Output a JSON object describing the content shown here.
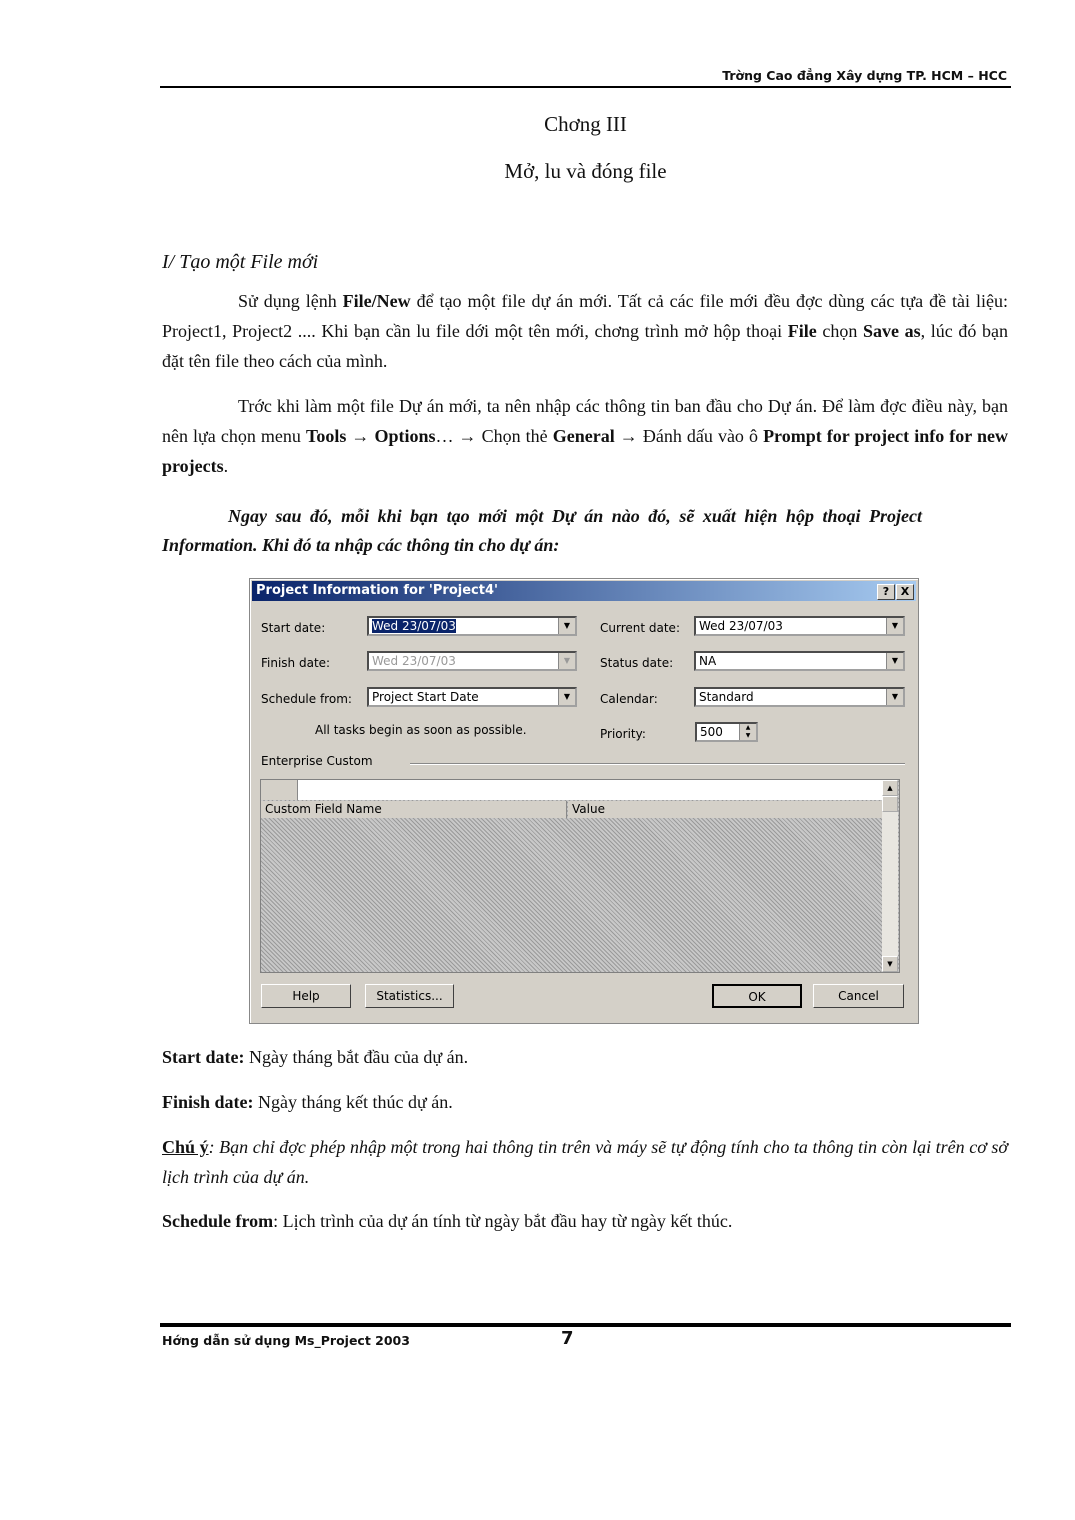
{
  "header": {
    "school": "Trờng   Cao đẳng Xây dựng TP. HCM – HCC"
  },
  "chapter": {
    "number": "Chơng   III",
    "title": "Mở, lu   và đóng file"
  },
  "section": {
    "heading": "I/ Tạo một File mới"
  },
  "para1": {
    "s1": "Sử dụng lệnh ",
    "b1": "File/New",
    "s2": " để tạo một file dự án mới. Tất cả các file mới đều đợc   dùng các tựa đề tài liệu: Project1, Project2 .... Khi bạn cần lu   file dới   một tên mới, chơng   trình mở hộp thoại ",
    "b2": "File",
    "s3": " chọn ",
    "b3": "Save as",
    "s4": ", lúc đó bạn đặt tên file theo cách của mình."
  },
  "para2": {
    "s1": "Trớc   khi làm một file Dự án mới, ta nên nhập các thông tin ban đầu cho Dự án. Để làm đợc điều này, bạn nên lựa chọn menu ",
    "b1": "Tools → Options",
    "s2": "… → Chọn thẻ ",
    "b2": "General",
    "s3": " → Đánh dấu vào ô ",
    "b3": "Prompt for project info for new projects",
    "s4": "."
  },
  "para3": {
    "text": "Ngay sau đó, mỗi khi bạn tạo mới một Dự án nào đó, sẽ xuất hiện hộp thoại Project Information. Khi đó ta nhập các thông tin cho dự án:"
  },
  "dialog": {
    "title": "Project Information for 'Project4'",
    "help_icon": "?",
    "close_icon": "X",
    "start_date_label": "Start date:",
    "start_date": "Wed 23/07/03",
    "finish_date_label": "Finish date:",
    "finish_date": "Wed 23/07/03",
    "schedule_from_label": "Schedule from:",
    "schedule_from": "Project Start Date",
    "current_date_label": "Current date:",
    "current_date": "Wed 23/07/03",
    "status_date_label": "Status date:",
    "status_date": "NA",
    "calendar_label": "Calendar:",
    "calendar": "Standard",
    "priority_label": "Priority:",
    "priority": "500",
    "note": "All tasks begin as soon as possible.",
    "enterprise_label": "Enterprise Custom",
    "columns": [
      "Custom Field Name",
      "Value"
    ],
    "buttons": {
      "help": "Help",
      "statistics": "Statistics...",
      "ok": "OK",
      "cancel": "Cancel"
    }
  },
  "defs": {
    "start_b": "Start date:",
    "start_t": " Ngày tháng bắt đầu của dự án.",
    "finish_b": "Finish date:",
    "finish_t": " Ngày tháng kết thúc dự án.",
    "note_b": "Chú ý",
    "note_t": ": Bạn chỉ đợc   phép nhập một trong hai thông tin trên và máy sẽ tự động tính cho ta thông tin còn lại trên cơ sở lịch trình của dự án.",
    "sched_b": "Schedule from",
    "sched_t": ": Lịch trình của dự án tính từ ngày bắt đầu hay từ ngày kết thúc."
  },
  "footer": {
    "title": "Hớng   dẫn sử dụng Ms_Project 2003",
    "page": "7"
  }
}
